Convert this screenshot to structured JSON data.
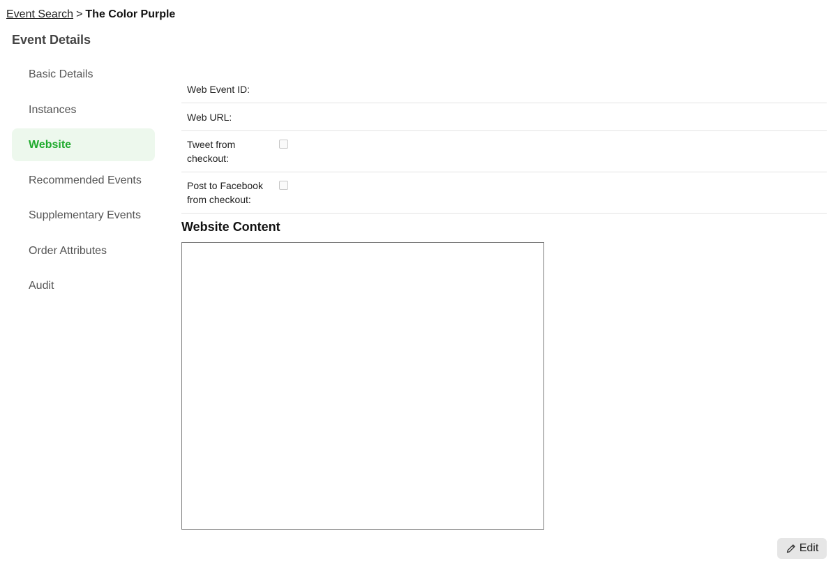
{
  "breadcrumb": {
    "parent": "Event Search",
    "separator": ">",
    "current": "The Color Purple"
  },
  "section_title": "Event Details",
  "sidebar": {
    "items": [
      {
        "label": "Basic Details",
        "active": false
      },
      {
        "label": "Instances",
        "active": false
      },
      {
        "label": "Website",
        "active": true
      },
      {
        "label": "Recommended Events",
        "active": false
      },
      {
        "label": "Supplementary Events",
        "active": false
      },
      {
        "label": "Order Attributes",
        "active": false
      },
      {
        "label": "Audit",
        "active": false
      }
    ]
  },
  "fields": {
    "web_event_id": {
      "label": "Web Event ID:",
      "value": ""
    },
    "web_url": {
      "label": "Web URL:",
      "value": ""
    },
    "tweet_from_checkout": {
      "label": "Tweet from checkout:",
      "checked": false
    },
    "post_to_facebook": {
      "label": "Post to Facebook from checkout:",
      "checked": false
    }
  },
  "website_content": {
    "title": "Website Content",
    "value": ""
  },
  "edit_button": {
    "label": "Edit",
    "icon": "pencil-icon"
  },
  "colors": {
    "active_text": "#1faa2d",
    "active_bg": "#edf8ed",
    "button_bg": "#e6e6e6"
  }
}
